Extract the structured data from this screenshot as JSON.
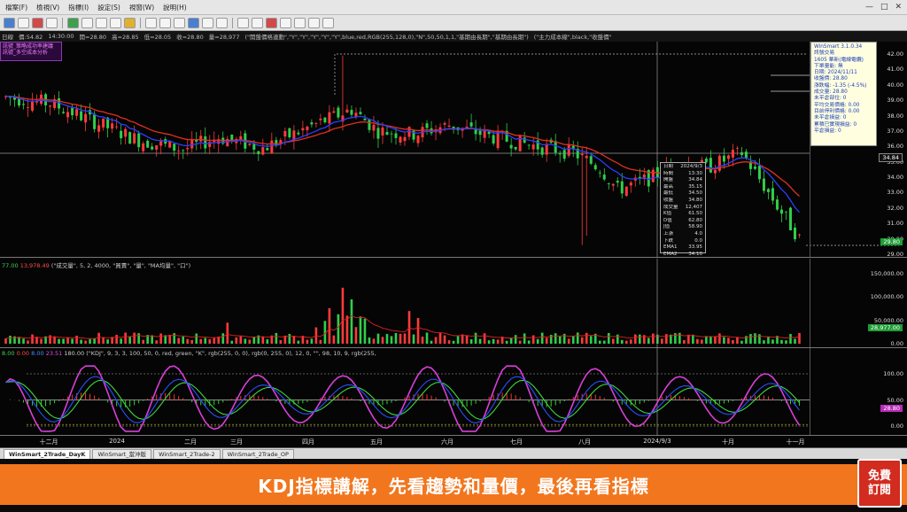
{
  "menubar": {
    "items": [
      "檔案(F)",
      "檢視(V)",
      "指標(I)",
      "設定(S)",
      "視窗(W)",
      "說明(H)"
    ]
  },
  "window_controls": [
    "—",
    "□",
    "✕"
  ],
  "infobar": {
    "items": [
      "日線",
      "價:54.82",
      "14:30:00",
      "開=28.80",
      "高=28.85",
      "低=28.05",
      "收=28.80",
      "量=28,977",
      "(\"開盤價格連動\",\"Y\",\"Y\",\"Y\",\"Y\",\"Y\",blue,red,RGB(255,128,0),\"N\",50,50,1,1,\"基期由長期\",\"基期由長期\")",
      "(\"主力成本線\",black,\"收盤價\""
    ]
  },
  "strategy_box": {
    "line1": "訊號_策略成功率建議",
    "line2": "訊號_多空成本分析"
  },
  "price": {
    "yticks": [
      "42.00",
      "41.00",
      "40.00",
      "39.00",
      "38.00",
      "37.00",
      "36.00",
      "35.00",
      "34.00",
      "33.00",
      "32.00",
      "31.00",
      "30.00",
      "29.00"
    ],
    "cursor_tag": "34.84",
    "last_tag": "29.80"
  },
  "infopanel": {
    "lines": [
      "WinSmart 3.1.0.34",
      "訊號交易",
      "1605 華新(電線電纜)",
      "下單量能: 無",
      "日期: 2024/11/11",
      "收盤價: 28.80",
      "漲跌幅: -1.35 (-4.5%)",
      "成交量: 28.80",
      "未平倉部位: 0",
      "平均交易價格: 0.00",
      "目前停利價格: 0.00",
      "未平倉損益: 0",
      "累積已實現損益: 0",
      "平倉損益: 0"
    ]
  },
  "cursorpanel": {
    "rows": [
      [
        "日期",
        "2024/9/3"
      ],
      [
        "時間",
        "13:30"
      ],
      [
        "開盤",
        "34.84"
      ],
      [
        "最高",
        "35.15"
      ],
      [
        "最低",
        "34.50"
      ],
      [
        "收盤",
        "34.80"
      ],
      [
        "成交量",
        "12,407"
      ],
      [
        "K值",
        "61.50"
      ],
      [
        "D值",
        "62.80"
      ],
      [
        "J值",
        "58.90"
      ],
      [
        "上漲",
        "4.0"
      ],
      [
        "下跌",
        "0.0"
      ],
      [
        "EMA1",
        "33.95"
      ],
      [
        "EMA2",
        "34.10"
      ]
    ]
  },
  "volume": {
    "header": [
      "77.00",
      "13,978.49",
      "(\"成交量\", 5, 2, 4000, \"買賣\", \"量\", \"MA均量\", \"口\")"
    ],
    "yticks": [
      "150,000.00",
      "100,000.00",
      "50,000.00",
      "0.00"
    ],
    "tag": "28,977.00"
  },
  "kdj": {
    "header": [
      "8.00",
      "0.00",
      "8.00",
      "23.51",
      "180.00",
      "(\"KDJ\", 9, 3, 3, 100, 50, 0, red, green, \"K\", rgb(255, 0, 0), rgb(0, 255, 0), 12, 0, \"\", 98, 10, 9, rgb(255,"
    ],
    "yticks": [
      "100.00",
      "50.00",
      "0.00"
    ],
    "tag": "28.80"
  },
  "xaxis": {
    "labels": [
      "十二月",
      "2024",
      "二月",
      "三月",
      "四月",
      "五月",
      "六月",
      "七月",
      "八月",
      "2024/9/3",
      "十月",
      "十一月"
    ]
  },
  "tabs": [
    "WinSmart_2Trade_DayK",
    "WinSmart_當沖版",
    "WinSmart_2Trade-2",
    "WinSmart_2Trade_OP"
  ],
  "subtitle": {
    "text": "KDJ指標講解，先看趨勢和量價，最後再看指標"
  },
  "freebtn": {
    "line1": "免費",
    "line2": "訂閱"
  },
  "colors": {
    "up": "#ff3b3b",
    "down": "#2fcf4a",
    "k_line": "#d83fd8",
    "d_line": "#3cd83c",
    "j_line": "#2a4dff",
    "ema_red": "#e0301e",
    "ema_blue": "#2b3fff"
  }
}
